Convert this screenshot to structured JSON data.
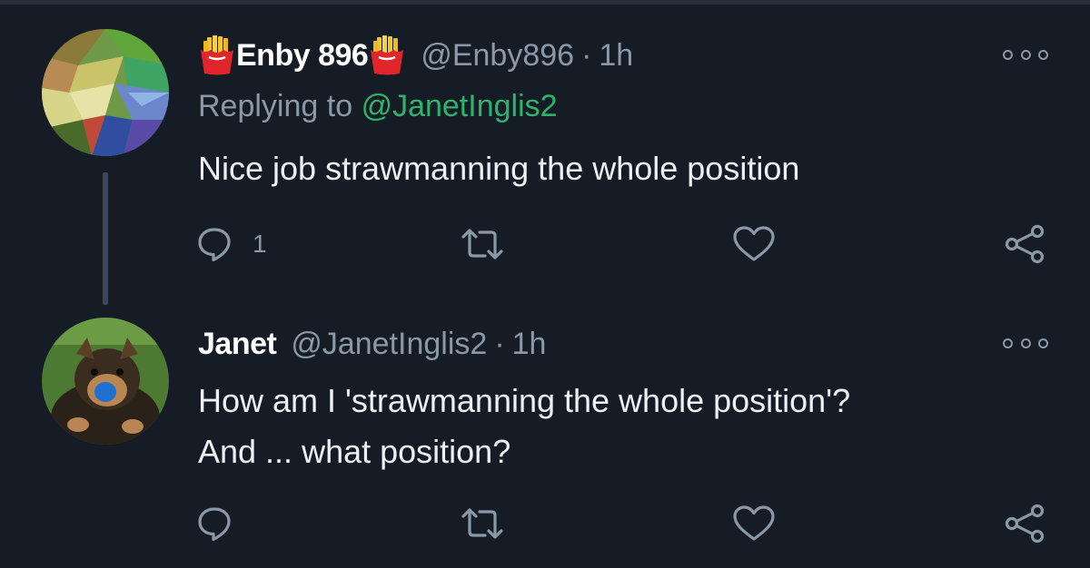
{
  "tweets": [
    {
      "display_name": "Enby 896",
      "handle": "@Enby896",
      "separator": "·",
      "time": "1h",
      "replying_prefix": "Replying to",
      "replying_to": "@JanetInglis2",
      "text_lines": [
        "Nice job strawmanning the whole position"
      ],
      "reply_count": "1",
      "name_emoji": "fries-icon"
    },
    {
      "display_name": "Janet",
      "handle": "@JanetInglis2",
      "separator": "·",
      "time": "1h",
      "text_lines": [
        "How am I 'strawmanning the whole position'?",
        "And ... what position?"
      ],
      "reply_count": ""
    }
  ],
  "colors": {
    "background": "#151c26",
    "secondary_text": "#8b98a5",
    "mention": "#2fb36a",
    "primary_text": "#eef1f4"
  }
}
